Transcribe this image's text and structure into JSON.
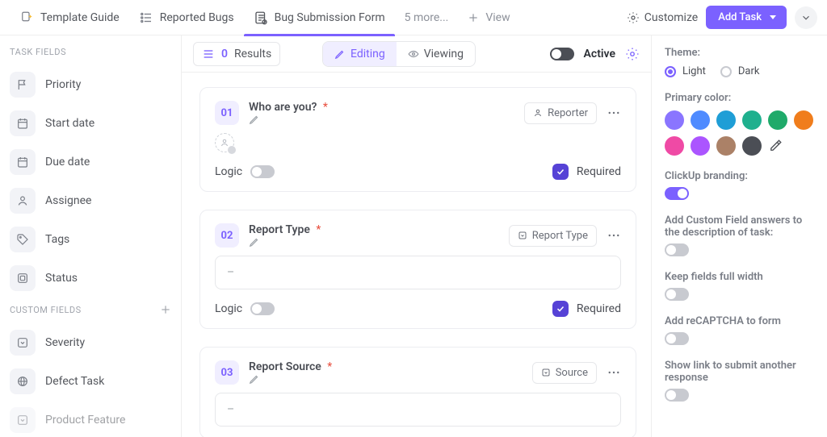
{
  "topbar": {
    "tabs": [
      {
        "label": "Template Guide"
      },
      {
        "label": "Reported Bugs"
      },
      {
        "label": "Bug Submission Form"
      }
    ],
    "more": "5 more...",
    "view": "View",
    "customize": "Customize",
    "add_task": "Add Task"
  },
  "sidebar": {
    "task_fields_header": "TASK FIELDS",
    "task_fields": [
      {
        "label": "Priority"
      },
      {
        "label": "Start date"
      },
      {
        "label": "Due date"
      },
      {
        "label": "Assignee"
      },
      {
        "label": "Tags"
      },
      {
        "label": "Status"
      }
    ],
    "custom_fields_header": "CUSTOM FIELDS",
    "custom_fields": [
      {
        "label": "Severity"
      },
      {
        "label": "Defect Task"
      },
      {
        "label": "Product Feature"
      }
    ]
  },
  "toolbar": {
    "results_count": "0",
    "results_label": "Results",
    "editing": "Editing",
    "viewing": "Viewing",
    "active": "Active"
  },
  "questions": [
    {
      "num": "01",
      "title": "Who are you?",
      "required": true,
      "tag": "Reporter",
      "has_avatar_slot": true,
      "logic": "Logic",
      "required_label": "Required"
    },
    {
      "num": "02",
      "title": "Report Type",
      "required": true,
      "tag": "Report Type",
      "placeholder": "–",
      "logic": "Logic",
      "required_label": "Required"
    },
    {
      "num": "03",
      "title": "Report Source",
      "required": true,
      "tag": "Source",
      "placeholder": "–"
    }
  ],
  "panel": {
    "theme_label": "Theme:",
    "light": "Light",
    "dark": "Dark",
    "primary_label": "Primary color:",
    "swatches": [
      "#8a75ff",
      "#4f8bff",
      "#1f9ed6",
      "#1fb08e",
      "#1faa6a",
      "#f07d1c",
      "#ef4aa5",
      "#ab55ff",
      "#ab8167",
      "#4b4e55"
    ],
    "branding_label": "ClickUp branding:",
    "desc_label": "Add Custom Field answers to the description of task:",
    "fullwidth_label": "Keep fields full width",
    "recaptcha_label": "Add reCAPTCHA to form",
    "another_label": "Show link to submit another response"
  }
}
